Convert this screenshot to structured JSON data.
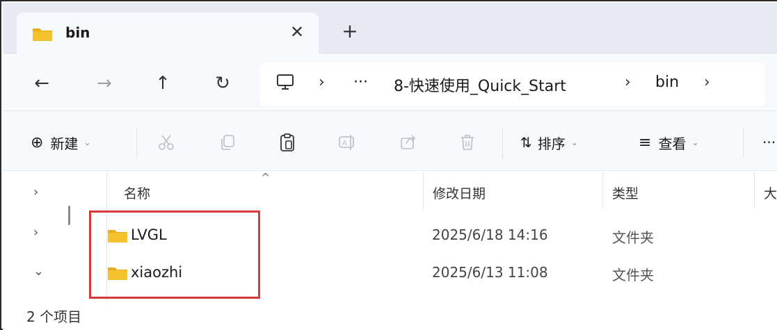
{
  "tab": {
    "title": "bin",
    "close_symbol": "✕",
    "new_tab_symbol": "+"
  },
  "nav": {
    "back": "←",
    "forward": "→",
    "up": "↑",
    "refresh": "↻",
    "breadcrumb": {
      "sep1": "›",
      "ellipsis": "···",
      "folder": "8-快速使用_Quick_Start",
      "sep2": "›",
      "current": "bin",
      "sep3": "›"
    }
  },
  "toolbar": {
    "new_icon": "⊕",
    "new_label": "新建",
    "sort_icon": "⇅",
    "sort_label": "排序",
    "view_icon": "≡",
    "view_label": "查看",
    "more": "···",
    "chevron": "⌄"
  },
  "columns": {
    "name": "名称",
    "date": "修改日期",
    "type": "类型",
    "size": "大"
  },
  "files": [
    {
      "name": "LVGL",
      "date": "2025/6/18 14:16",
      "type": "文件夹"
    },
    {
      "name": "xiaozhi",
      "date": "2025/6/13 11:08",
      "type": "文件夹"
    }
  ],
  "leftnav_chevrons": [
    "›",
    "›",
    "⌄"
  ],
  "status": {
    "text": "2 个项目"
  },
  "colors": {
    "folder": "#f5c22e",
    "highlight": "#d63a3a",
    "chrome_bg": "#f6f9fd",
    "tabstrip_bg": "#e6ebf3"
  }
}
